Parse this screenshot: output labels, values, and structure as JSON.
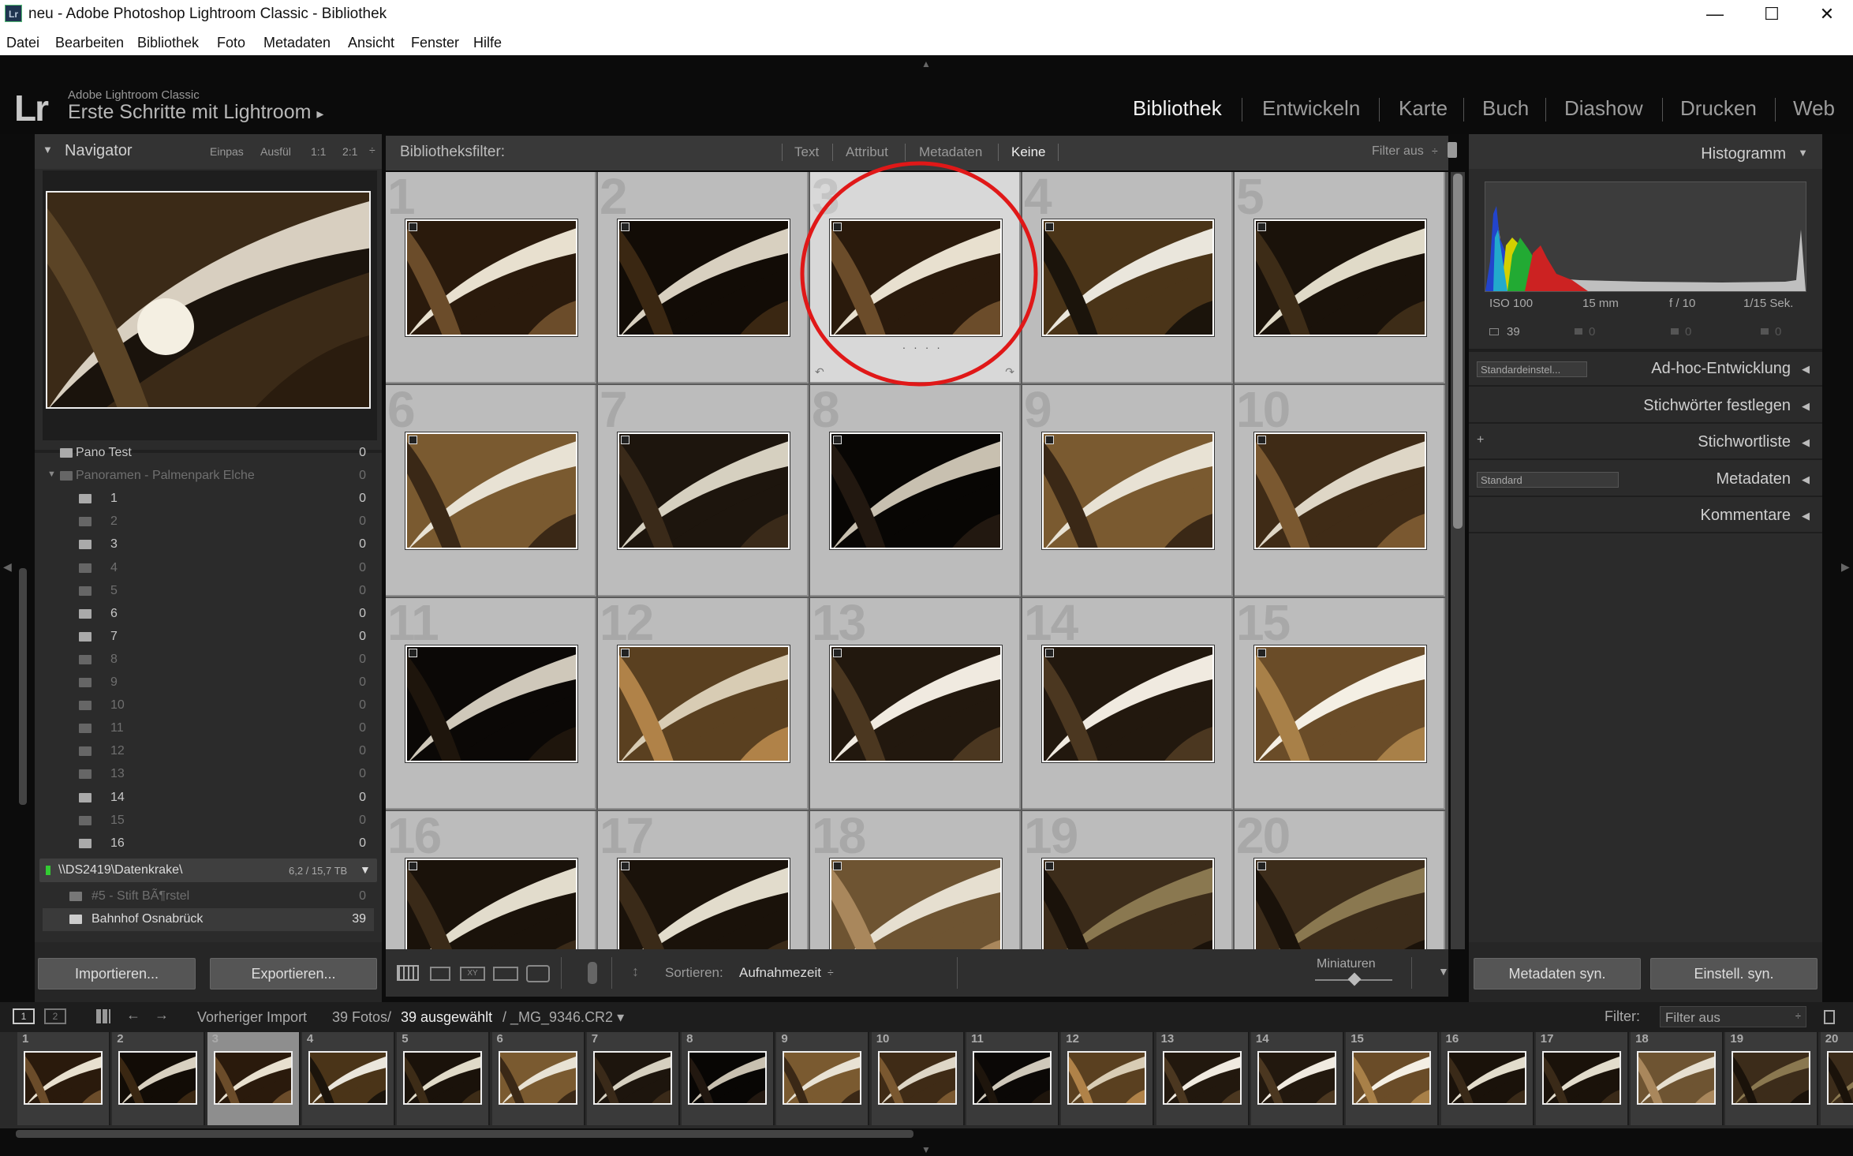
{
  "window": {
    "title": "neu - Adobe Photoshop Lightroom Classic - Bibliothek",
    "minimize": "—",
    "maximize": "☐",
    "close": "✕",
    "app_icon": "Lr"
  },
  "menu": [
    "Datei",
    "Bearbeiten",
    "Bibliothek",
    "Foto",
    "Metadaten",
    "Ansicht",
    "Fenster",
    "Hilfe"
  ],
  "identity": {
    "logo": "Lr",
    "app": "Adobe Lightroom Classic",
    "catalog": "Erste Schritte mit Lightroom",
    "arrow": "▸"
  },
  "modules": [
    "Bibliothek",
    "Entwickeln",
    "Karte",
    "Buch",
    "Diashow",
    "Drucken",
    "Web"
  ],
  "navigator": {
    "title": "Navigator",
    "triangle": "▼",
    "zooms": [
      "Einpas",
      "Ausfül",
      "1:1",
      "2:1"
    ],
    "zoom_menu": "÷"
  },
  "folders": [
    {
      "name": "Pano Test",
      "count": "0",
      "dim": false,
      "indent": 0,
      "expander": ""
    },
    {
      "name": "Panoramen - Palmenpark Elche",
      "count": "0",
      "dim": true,
      "indent": 0,
      "expander": "▼"
    },
    {
      "name": "1",
      "count": "0",
      "dim": false,
      "indent": 1,
      "expander": ""
    },
    {
      "name": "2",
      "count": "0",
      "dim": true,
      "indent": 1,
      "expander": ""
    },
    {
      "name": "3",
      "count": "0",
      "dim": false,
      "indent": 1,
      "expander": ""
    },
    {
      "name": "4",
      "count": "0",
      "dim": true,
      "indent": 1,
      "expander": ""
    },
    {
      "name": "5",
      "count": "0",
      "dim": true,
      "indent": 1,
      "expander": ""
    },
    {
      "name": "6",
      "count": "0",
      "dim": false,
      "indent": 1,
      "expander": ""
    },
    {
      "name": "7",
      "count": "0",
      "dim": false,
      "indent": 1,
      "expander": ""
    },
    {
      "name": "8",
      "count": "0",
      "dim": true,
      "indent": 1,
      "expander": ""
    },
    {
      "name": "9",
      "count": "0",
      "dim": true,
      "indent": 1,
      "expander": ""
    },
    {
      "name": "10",
      "count": "0",
      "dim": true,
      "indent": 1,
      "expander": ""
    },
    {
      "name": "11",
      "count": "0",
      "dim": true,
      "indent": 1,
      "expander": ""
    },
    {
      "name": "12",
      "count": "0",
      "dim": true,
      "indent": 1,
      "expander": ""
    },
    {
      "name": "13",
      "count": "0",
      "dim": true,
      "indent": 1,
      "expander": ""
    },
    {
      "name": "14",
      "count": "0",
      "dim": false,
      "indent": 1,
      "expander": ""
    },
    {
      "name": "15",
      "count": "0",
      "dim": true,
      "indent": 1,
      "expander": ""
    },
    {
      "name": "16",
      "count": "0",
      "dim": false,
      "indent": 1,
      "expander": ""
    }
  ],
  "volume": {
    "name": "\\\\DS2419\\Datenkrake\\",
    "size": "6,2 / 15,7 TB",
    "menu": "▼"
  },
  "folders2": [
    {
      "name": "#5 - Stift BÃ¶rstel",
      "count": "0",
      "dim": true
    },
    {
      "name": "Bahnhof Osnabrück",
      "count": "39",
      "dim": false
    }
  ],
  "left_buttons": {
    "import": "Importieren...",
    "export": "Exportieren..."
  },
  "filter": {
    "label": "Bibliotheksfilter:",
    "tabs": [
      "Text",
      "Attribut",
      "Metadaten",
      "Keine"
    ],
    "active": "Keine",
    "preset": "Filter aus",
    "preset_arrow": "÷",
    "lock": "🔒"
  },
  "grid": {
    "cells": [
      {
        "n": "1",
        "tone": "a"
      },
      {
        "n": "2",
        "tone": "b"
      },
      {
        "n": "3",
        "tone": "a",
        "sel": true
      },
      {
        "n": "4",
        "tone": "c"
      },
      {
        "n": "5",
        "tone": "d"
      },
      {
        "n": "6",
        "tone": "e"
      },
      {
        "n": "7",
        "tone": "f"
      },
      {
        "n": "8",
        "tone": "g"
      },
      {
        "n": "9",
        "tone": "e"
      },
      {
        "n": "10",
        "tone": "h"
      },
      {
        "n": "11",
        "tone": "i"
      },
      {
        "n": "12",
        "tone": "j"
      },
      {
        "n": "13",
        "tone": "k"
      },
      {
        "n": "14",
        "tone": "k"
      },
      {
        "n": "15",
        "tone": "l"
      },
      {
        "n": "16",
        "tone": "m"
      },
      {
        "n": "17",
        "tone": "m"
      },
      {
        "n": "18",
        "tone": "n"
      },
      {
        "n": "19",
        "tone": "o"
      },
      {
        "n": "20",
        "tone": "o"
      }
    ],
    "dots": "· · · ·"
  },
  "toolbar": {
    "sort_label": "Sortieren:",
    "sort_value": "Aufnahmezeit",
    "sort_arrow": "÷",
    "size_label": "Miniaturen",
    "menu": "▼"
  },
  "histogram": {
    "title": "Histogramm",
    "iso": "ISO 100",
    "focal": "15 mm",
    "aperture": "f / 10",
    "shutter": "1/15 Sek.",
    "count": "39",
    "zeros": [
      "0",
      "0",
      "0"
    ]
  },
  "right_sections": [
    {
      "label": "Ad-hoc-Entwicklung",
      "select": "Standardeinstel...",
      "plus": ""
    },
    {
      "label": "Stichwörter festlegen",
      "select": "",
      "plus": ""
    },
    {
      "label": "Stichwortliste",
      "select": "",
      "plus": "+"
    },
    {
      "label": "Metadaten",
      "select": "Standard",
      "plus": ""
    },
    {
      "label": "Kommentare",
      "select": "",
      "plus": ""
    }
  ],
  "right_buttons": {
    "sync_meta": "Metadaten syn.",
    "sync_settings": "Einstell. syn."
  },
  "filmstrip_header": {
    "views": [
      "1",
      "2"
    ],
    "source": "Vorheriger Import",
    "count": "39 Fotos/",
    "selected": "39 ausgewählt",
    "file": "/ _MG_9346.CR2 ▾",
    "filter_label": "Filter:",
    "filter_value": "Filter aus"
  },
  "filmstrip": [
    {
      "n": "1",
      "tone": "a"
    },
    {
      "n": "2",
      "tone": "b"
    },
    {
      "n": "3",
      "tone": "a",
      "sel": true
    },
    {
      "n": "4",
      "tone": "c"
    },
    {
      "n": "5",
      "tone": "d"
    },
    {
      "n": "6",
      "tone": "e"
    },
    {
      "n": "7",
      "tone": "f"
    },
    {
      "n": "8",
      "tone": "g"
    },
    {
      "n": "9",
      "tone": "e"
    },
    {
      "n": "10",
      "tone": "h"
    },
    {
      "n": "11",
      "tone": "i"
    },
    {
      "n": "12",
      "tone": "j"
    },
    {
      "n": "13",
      "tone": "k"
    },
    {
      "n": "14",
      "tone": "k"
    },
    {
      "n": "15",
      "tone": "l"
    },
    {
      "n": "16",
      "tone": "m"
    },
    {
      "n": "17",
      "tone": "m"
    },
    {
      "n": "18",
      "tone": "n"
    },
    {
      "n": "19",
      "tone": "o"
    },
    {
      "n": "20",
      "tone": "o"
    }
  ],
  "colors": {
    "annotation_circle": "#e01818",
    "panel": "#2b2b2b",
    "grid_cell": "#bcbcbc"
  }
}
